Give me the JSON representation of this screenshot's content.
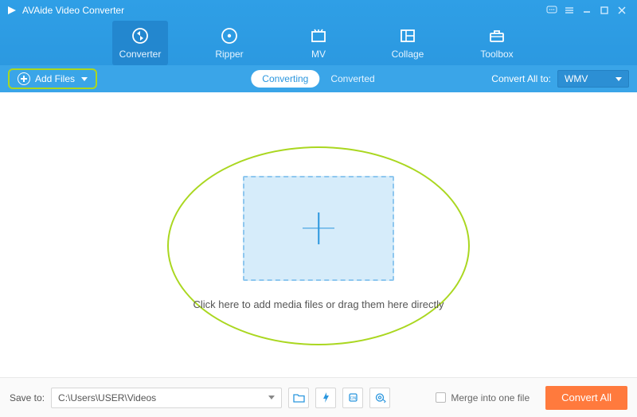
{
  "app": {
    "title": "AVAide Video Converter"
  },
  "nav": {
    "tabs": [
      {
        "label": "Converter",
        "active": true
      },
      {
        "label": "Ripper",
        "active": false
      },
      {
        "label": "MV",
        "active": false
      },
      {
        "label": "Collage",
        "active": false
      },
      {
        "label": "Toolbox",
        "active": false
      }
    ]
  },
  "subbar": {
    "add_files_label": "Add Files",
    "mode_tabs": {
      "converting": "Converting",
      "converted": "Converted"
    },
    "convert_all_to_label": "Convert All to:",
    "format_selected": "WMV"
  },
  "main": {
    "drop_hint": "Click here to add media files or drag them here directly"
  },
  "footer": {
    "save_to_label": "Save to:",
    "save_path": "C:\\Users\\USER\\Videos",
    "merge_label": "Merge into one file",
    "convert_all_label": "Convert All"
  }
}
